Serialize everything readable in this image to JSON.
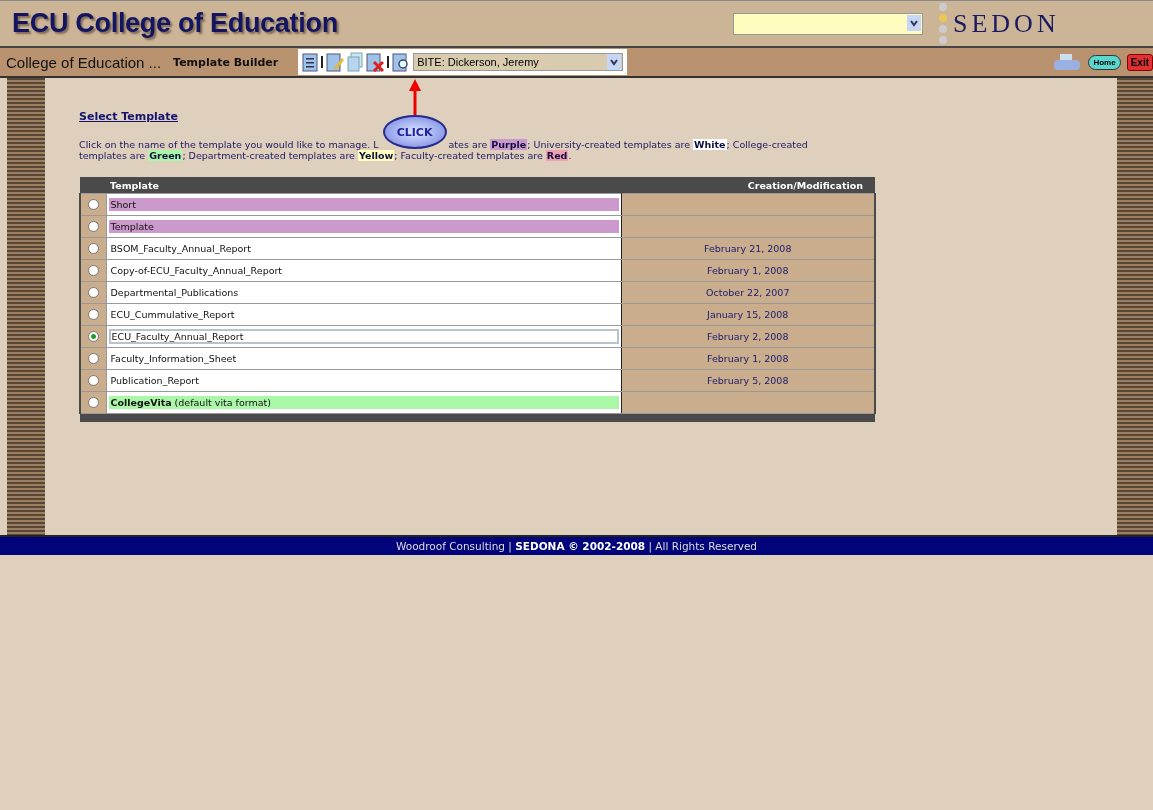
{
  "header": {
    "title": "ECU College of Education",
    "logo": "SEDON"
  },
  "subheader": {
    "college": "College of Education ...",
    "page": "Template Builder",
    "person_select": "BITE: Dickerson, Jeremy",
    "home": "Home",
    "exit": "Exit"
  },
  "callout": {
    "label": "CLICK"
  },
  "section": {
    "heading": "Select Template"
  },
  "intro": {
    "line_1_start": "Click on the name of the template you would like to manage. L",
    "line_1_end": [
      {
        "text": "ates are "
      },
      {
        "text": "Purple",
        "color": "#cc99cc"
      },
      {
        "text": "; University-created templates are "
      },
      {
        "text": "White",
        "color": "#ffffff"
      },
      {
        "text": "; College-created"
      }
    ],
    "line_2": [
      {
        "text": "templates are "
      },
      {
        "text": "Green",
        "color": "#aaf7a8"
      },
      {
        "text": "; Department-created templates are "
      },
      {
        "text": "Yellow",
        "color": "#ffffc0"
      },
      {
        "text": "; Faculty-created templates are "
      },
      {
        "text": "Red",
        "color": "#f0a0b0"
      },
      {
        "text": "."
      }
    ]
  },
  "table": {
    "columns": [
      "Template",
      "Creation/Modification"
    ],
    "rows": [
      {
        "name": "Short",
        "date": "",
        "color": "#cc99cc",
        "selected": false
      },
      {
        "name": "Template",
        "date": "",
        "color": "#cc99cc",
        "selected": false
      },
      {
        "name": "BSOM_Faculty_Annual_Report",
        "date": "February 21, 2008",
        "color": "#ffffff",
        "selected": false
      },
      {
        "name": "Copy-of-ECU_Faculty_Annual_Report",
        "date": "February 1, 2008",
        "color": "#ffffff",
        "selected": false
      },
      {
        "name": "Departmental_Publications",
        "date": "October 22, 2007",
        "color": "#ffffff",
        "selected": false
      },
      {
        "name": "ECU_Cummulative_Report",
        "date": "January 15, 2008",
        "color": "#ffffff",
        "selected": false
      },
      {
        "name": "ECU_Faculty_Annual_Report",
        "date": "February 2, 2008",
        "color": "#ffffff",
        "selected": true
      },
      {
        "name": "Faculty_Information_Sheet",
        "date": "February 1, 2008",
        "color": "#ffffff",
        "selected": false
      },
      {
        "name": "Publication_Report",
        "date": "February 5, 2008",
        "color": "#ffffff",
        "selected": false
      },
      {
        "name": "**CollegeVita** (default vita format)",
        "date": "",
        "color": "#aaf7a8",
        "selected": false
      }
    ]
  },
  "footer": {
    "before": "Woodroof Consulting |",
    "brand": "SEDONA © 2002-2008",
    "after": "| All Rights Reserved"
  }
}
